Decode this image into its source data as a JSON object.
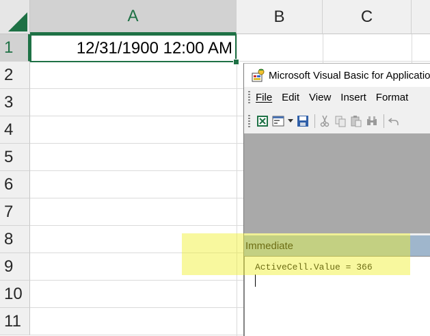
{
  "sheet": {
    "columns": [
      "A",
      "B",
      "C"
    ],
    "rows": [
      "1",
      "2",
      "3",
      "4",
      "5",
      "6",
      "7",
      "8",
      "9",
      "10",
      "11"
    ],
    "active_cell": "A1",
    "a1_value": "12/31/1900 12:00 AM"
  },
  "vba": {
    "title": "Microsoft Visual Basic for Applications",
    "menu": [
      "File",
      "Edit",
      "View",
      "Insert",
      "Format"
    ],
    "immediate": {
      "title": "Immediate",
      "code": "ActiveCell.Value = 366"
    }
  },
  "colors": {
    "excel_green": "#1e7145",
    "highlight": "#f0f028",
    "immediate_title": "#9fb6cc"
  }
}
